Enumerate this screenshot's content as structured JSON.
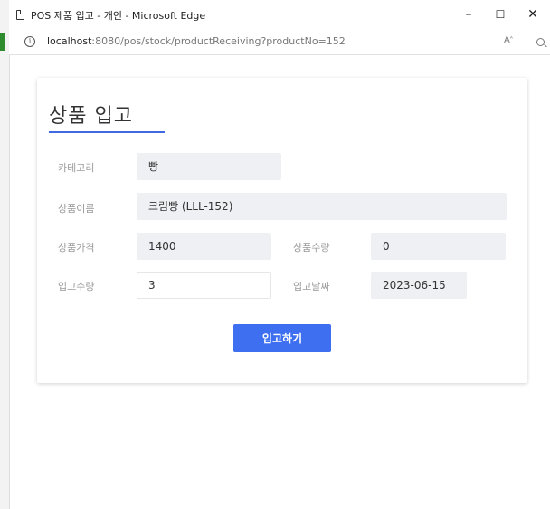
{
  "window": {
    "title": "POS 제품 입고 - 개인 - Microsoft Edge",
    "minimize": "–",
    "maximize": "☐",
    "close": "✕"
  },
  "address": {
    "info_glyph": "i",
    "host": "localhost",
    "path": ":8080/pos/stock/productReceiving?productNo=152",
    "read_aloud_glyph": "A",
    "read_aloud_sup": "ᴬ"
  },
  "page": {
    "title": "상품 입고"
  },
  "form": {
    "category": {
      "label": "카테고리",
      "value": "빵"
    },
    "name": {
      "label": "상품이름",
      "value": "크림빵 (LLL-152)"
    },
    "price": {
      "label": "상품가격",
      "value": "1400"
    },
    "stock": {
      "label": "상품수량",
      "value": "0"
    },
    "qty": {
      "label": "입고수량",
      "value": "3"
    },
    "date": {
      "label": "입고날짜",
      "value": "2023-06-15"
    }
  },
  "submit_label": "입고하기",
  "colors": {
    "accent": "#3d6ff0",
    "underline": "#4169e1",
    "field_bg": "#eef0f3"
  }
}
